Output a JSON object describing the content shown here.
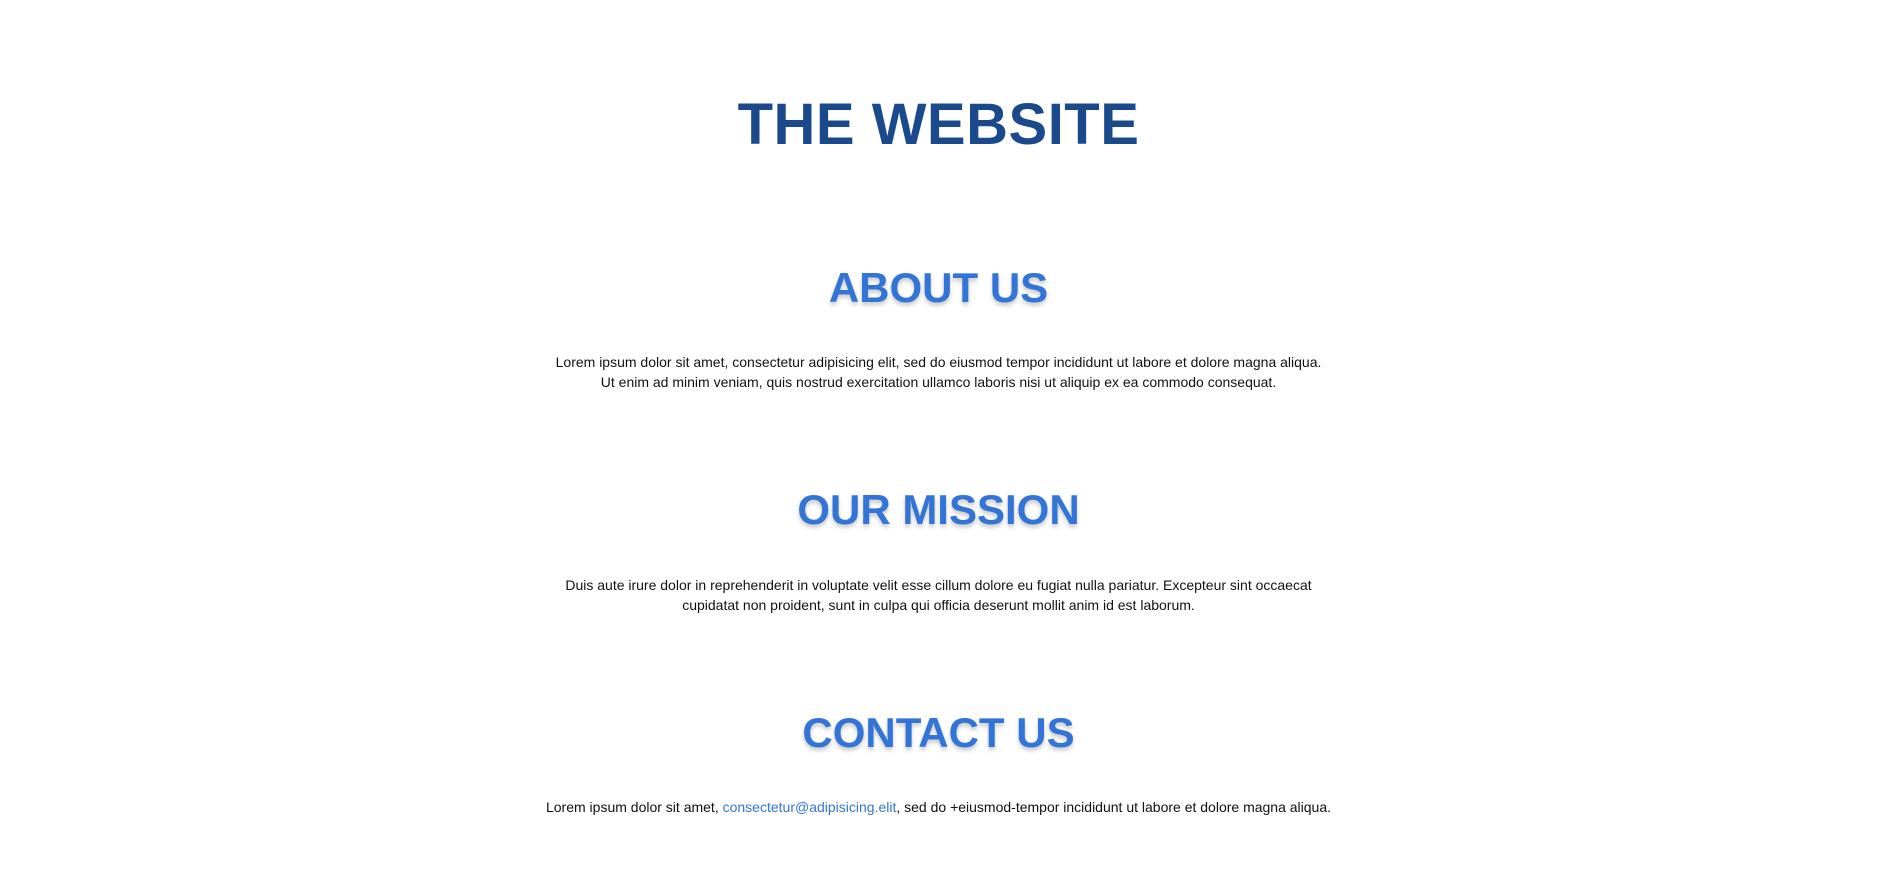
{
  "site": {
    "title": "THE WEBSITE"
  },
  "about": {
    "heading": "ABOUT US",
    "text": "Lorem ipsum dolor sit amet, consectetur adipisicing elit, sed do eiusmod tempor incididunt ut labore et dolore magna aliqua. Ut enim ad minim veniam, quis nostrud exercitation ullamco laboris nisi ut aliquip ex ea commodo consequat."
  },
  "mission": {
    "heading": "OUR MISSION",
    "text": "Duis aute irure dolor in reprehenderit in voluptate velit esse cillum dolore eu fugiat nulla pariatur. Excepteur sint occaecat cupidatat non proident, sunt in culpa qui officia deserunt mollit anim id est laborum."
  },
  "contact": {
    "heading": "CONTACT US",
    "text_before": "Lorem ipsum dolor sit amet, ",
    "email": "consectetur@adipisicing.elit",
    "text_after": ", sed do +eiusmod-tempor incididunt ut labore et dolore magna aliqua."
  },
  "colors": {
    "title": "#1b4a8c",
    "heading": "#3375d6",
    "link": "#3375d6",
    "body_text": "#111111",
    "background": "#ffffff"
  }
}
